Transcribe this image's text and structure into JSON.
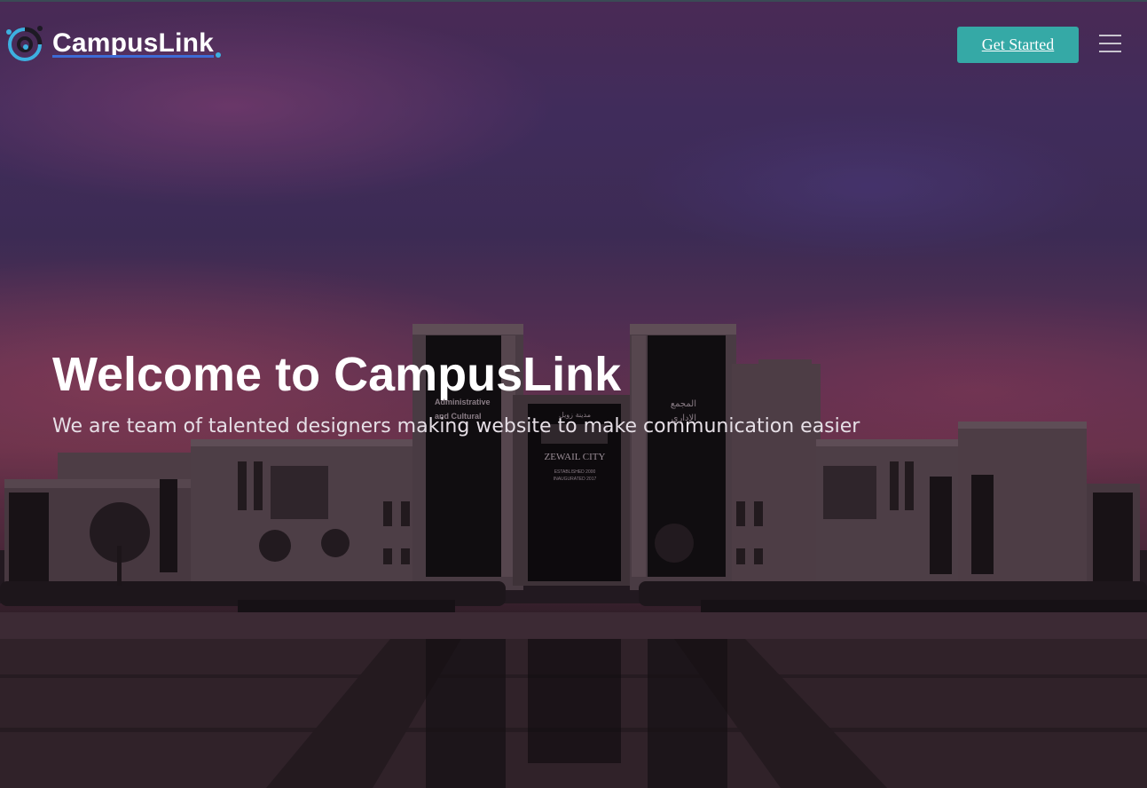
{
  "app": {
    "brand_name": "CampusLink"
  },
  "nav": {
    "cta_label": "Get Started",
    "menu_icon": "hamburger-menu-icon",
    "logo_icon": "campuslink-logo-icon"
  },
  "hero": {
    "title": "Welcome to CampusLink",
    "subtitle": "We are team of talented designers making website to make communication easier",
    "building_sign": {
      "english_line_1": "Administrative",
      "english_line_2": "and Cultural",
      "arabic_line_1": "المجمع",
      "arabic_line_2": "الإداري",
      "arabic_top": "مدينة زويل",
      "name": "ZEWAIL CITY",
      "established": "ESTABLISHED 2000",
      "inaugurated": "INAUGURATED 2017"
    }
  },
  "colors": {
    "cta_background": "#35a9a6",
    "brand_underline": "#3d6bd6",
    "logo_accent": "#3db0e0",
    "text_primary": "#ffffff"
  }
}
